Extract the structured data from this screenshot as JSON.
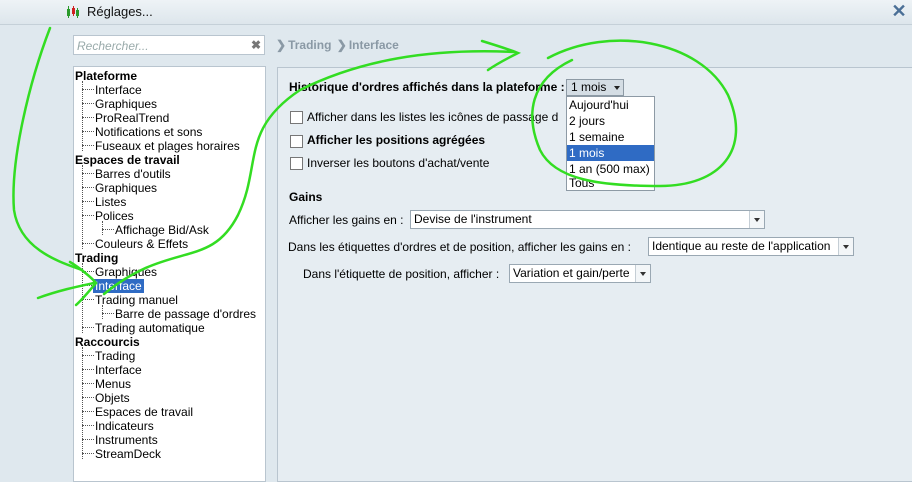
{
  "window": {
    "title": "Réglages...",
    "close_symbol": "✕"
  },
  "search": {
    "placeholder": "Rechercher...",
    "value": "",
    "clear_symbol": "✖"
  },
  "breadcrumb": {
    "items": [
      "Trading",
      "Interface"
    ],
    "separator": "❯"
  },
  "tree": {
    "categories": [
      {
        "label": "Plateforme",
        "items": [
          "Interface",
          "Graphiques",
          "ProRealTrend",
          "Notifications et sons",
          "Fuseaux et plages horaires"
        ]
      },
      {
        "label": "Espaces de travail",
        "items": [
          "Barres d'outils",
          "Graphiques",
          "Listes",
          "Polices",
          "Affichage Bid/Ask",
          "Couleurs & Effets"
        ]
      },
      {
        "label": "Trading",
        "items": [
          "Graphiques",
          "Interface",
          "Trading manuel",
          "Barre de passage d'ordres",
          "Trading automatique"
        ],
        "selected": "Interface"
      },
      {
        "label": "Raccourcis",
        "items": [
          "Trading",
          "Interface",
          "Menus",
          "Objets",
          "Espaces de travail",
          "Indicateurs",
          "Instruments",
          "StreamDeck"
        ]
      }
    ]
  },
  "settings": {
    "historique_label": "Historique d'ordres affichés dans la plateforme :",
    "historique_value": "1 mois",
    "historique_options": [
      "Aujourd'hui",
      "2 jours",
      "1 semaine",
      "1 mois",
      "1 an (500 max)",
      "Tous"
    ],
    "chk_icones": {
      "label": "Afficher dans les listes les icônes de passage d",
      "checked": false
    },
    "chk_agregees": {
      "label": "Afficher les positions agrégées",
      "checked": false
    },
    "chk_inverser": {
      "label": "Inverser les boutons d'achat/vente",
      "checked": false
    },
    "gains_heading": "Gains",
    "gains_label": "Afficher les gains en :",
    "gains_value": "Devise de l'instrument",
    "etiquettes_label": "Dans les étiquettes d'ordres et de position, afficher les gains en :",
    "etiquettes_value": "Identique au reste de l'application",
    "etiquette_pos_label": "Dans l'étiquette de position, afficher :",
    "etiquette_pos_value": "Variation et gain/perte"
  },
  "colors": {
    "selection": "#2f6bc4",
    "annotation": "#33dd22"
  },
  "icons": {
    "app": "chart-candles-icon",
    "close": "close-icon",
    "clear": "clear-search-icon"
  }
}
